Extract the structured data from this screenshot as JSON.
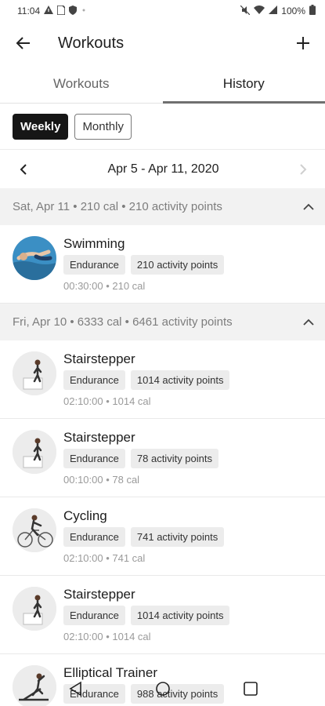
{
  "status_bar": {
    "time": "11:04",
    "left_icons": [
      "alert-icon",
      "sim-icon",
      "shield-icon"
    ],
    "battery": "100%"
  },
  "app_bar": {
    "title": "Workouts"
  },
  "tabs": [
    {
      "label": "Workouts",
      "active": false
    },
    {
      "label": "History",
      "active": true
    }
  ],
  "period_toggle": {
    "weekly": "Weekly",
    "monthly": "Monthly",
    "selected": "Weekly"
  },
  "date_range": "Apr 5 - Apr 11, 2020",
  "days": [
    {
      "header": "Sat, Apr 11 • 210 cal • 210 activity points",
      "workouts": [
        {
          "name": "Swimming",
          "tag": "Endurance",
          "points": "210 activity points",
          "meta": "00:30:00 • 210 cal",
          "icon": "swimming-icon"
        }
      ]
    },
    {
      "header": "Fri, Apr 10 • 6333 cal • 6461 activity points",
      "workouts": [
        {
          "name": "Stairstepper",
          "tag": "Endurance",
          "points": "1014 activity points",
          "meta": "02:10:00 • 1014 cal",
          "icon": "stairstepper-icon"
        },
        {
          "name": "Stairstepper",
          "tag": "Endurance",
          "points": "78 activity points",
          "meta": "00:10:00 • 78 cal",
          "icon": "stairstepper-icon"
        },
        {
          "name": "Cycling",
          "tag": "Endurance",
          "points": "741 activity points",
          "meta": "02:10:00 • 741 cal",
          "icon": "cycling-icon"
        },
        {
          "name": "Stairstepper",
          "tag": "Endurance",
          "points": "1014 activity points",
          "meta": "02:10:00 • 1014 cal",
          "icon": "stairstepper-icon"
        },
        {
          "name": "Elliptical Trainer",
          "tag": "Endurance",
          "points": "988 activity points",
          "icon": "elliptical-icon"
        }
      ]
    }
  ]
}
